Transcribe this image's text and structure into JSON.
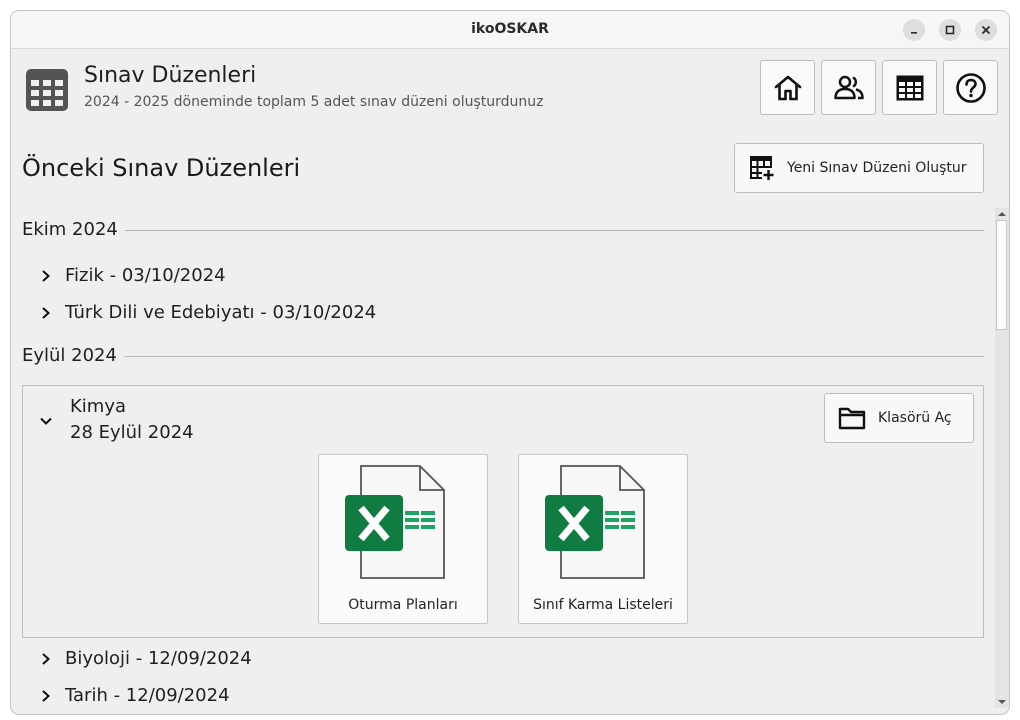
{
  "window": {
    "title": "ikoOSKAR"
  },
  "header": {
    "title": "Sınav Düzenleri",
    "subtitle": "2024 - 2025 döneminde toplam 5 adet sınav düzeni oluşturdunuz"
  },
  "nav": [
    {
      "icon": "home-icon"
    },
    {
      "icon": "users-icon"
    },
    {
      "icon": "table-icon"
    },
    {
      "icon": "help-icon"
    }
  ],
  "main": {
    "section_title": "Önceki Sınav Düzenleri",
    "new_button_label": "Yeni Sınav Düzeni Oluştur",
    "months": [
      "Ekim 2024",
      "Eylül 2024"
    ],
    "october_items": [
      {
        "text": "Fizik  -  03/10/2024"
      },
      {
        "text": "Türk Dili ve Edebiyatı  -  03/10/2024"
      }
    ],
    "expanded": {
      "name": "Kimya",
      "date": "28 Eylül 2024",
      "folder_button_label": "Klasörü Aç",
      "files": [
        {
          "label": "Oturma Planları"
        },
        {
          "label": "Sınıf Karma Listeleri"
        }
      ]
    },
    "september_items": [
      {
        "text": "Biyoloji  -  12/09/2024"
      },
      {
        "text": "Tarih  -  12/09/2024"
      }
    ]
  },
  "colors": {
    "excel_green": "#107c41",
    "excel_light": "#21a366"
  }
}
